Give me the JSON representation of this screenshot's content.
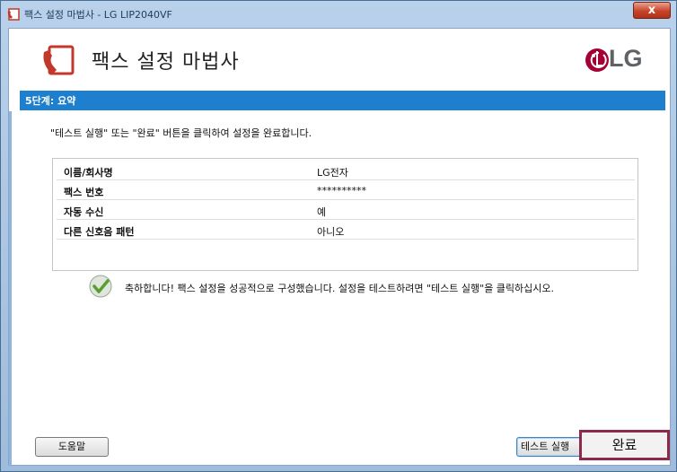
{
  "window": {
    "title": "팩스 설정 마법사 - LG LIP2040VF",
    "close_label": "x"
  },
  "header": {
    "title": "팩스 설정 마법사",
    "logo_text": "LG"
  },
  "step": {
    "label": "5단계: 요약"
  },
  "instruction": "\"테스트 실행\" 또는 \"완료\" 버튼을 클릭하여 설정을 완료합니다.",
  "summary": {
    "rows": [
      {
        "label": "이름/회사명",
        "value": "LG전자"
      },
      {
        "label": "팩스 번호",
        "value": "**********"
      },
      {
        "label": "자동 수신",
        "value": "예"
      },
      {
        "label": "다른 신호음 패턴",
        "value": "아니오"
      }
    ]
  },
  "success_message": "축하합니다! 팩스 설정을 성공적으로 구성했습니다. 설정을 테스트하려면 \"테스트 실행\"을 클릭하십시오.",
  "buttons": {
    "help": "도움말",
    "test": "테스트 실행",
    "finish": "완료"
  },
  "colors": {
    "step_bar": "#1e7fcf",
    "fax_icon": "#c0392b",
    "finish_border": "#8d2a4c",
    "success_check": "#5a9e2f"
  }
}
